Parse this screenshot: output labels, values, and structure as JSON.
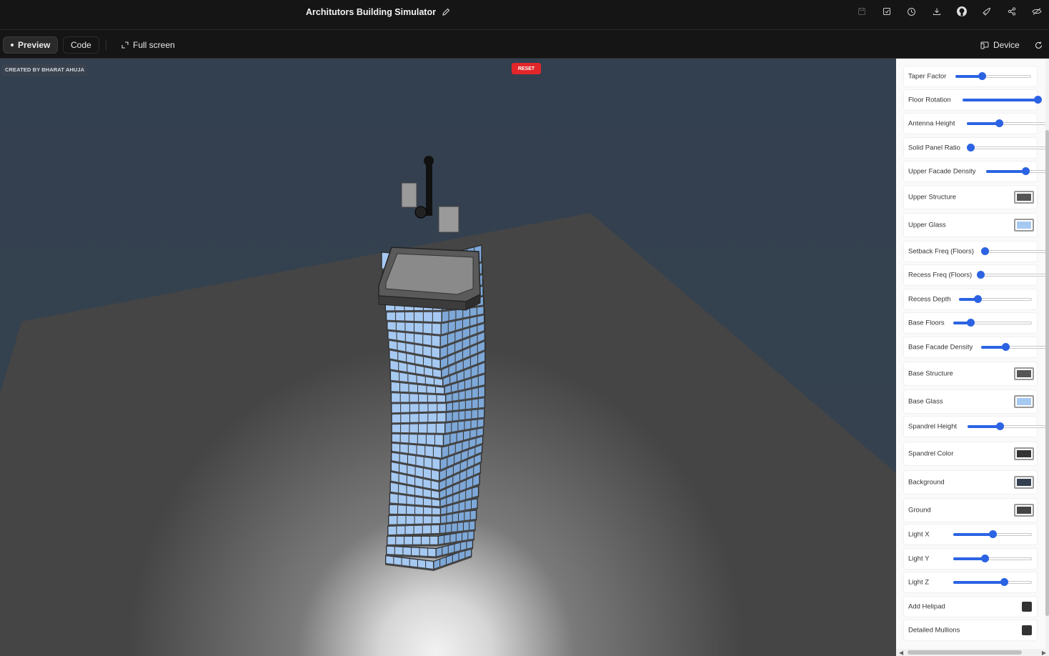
{
  "app": {
    "title": "Architutors Building Simulator"
  },
  "toolbar": {
    "preview_label": "Preview",
    "code_label": "Code",
    "fullscreen_label": "Full screen",
    "device_label": "Device"
  },
  "top_icons": [
    "save-icon",
    "save-as-icon",
    "history-icon",
    "download-icon",
    "github-icon",
    "deploy-rocket-icon",
    "share-icon",
    "hide-icon"
  ],
  "viewport": {
    "credit": "CREATED BY BHARAT AHUJA",
    "reset_label": "RESET"
  },
  "controls": [
    {
      "label": "Taper Factor",
      "type": "slider",
      "value": 0.35
    },
    {
      "label": "Floor Rotation",
      "type": "slider",
      "value": 0.97
    },
    {
      "label": "Antenna Height",
      "type": "slider",
      "value": 0.4
    },
    {
      "label": "Solid Panel Ratio",
      "type": "slider",
      "value": 0.0
    },
    {
      "label": "Upper Facade Density",
      "type": "slider",
      "value": 0.6
    },
    {
      "label": "Upper Structure",
      "type": "color",
      "value": "#555555"
    },
    {
      "label": "Upper Glass",
      "type": "color",
      "value": "#a6c9f2"
    },
    {
      "label": "Setback Freq (Floors)",
      "type": "slider",
      "value": 0.0
    },
    {
      "label": "Recess Freq (Floors)",
      "type": "slider",
      "value": 0.0
    },
    {
      "label": "Recess Depth",
      "type": "slider",
      "value": 0.25
    },
    {
      "label": "Base Floors",
      "type": "slider",
      "value": 0.22
    },
    {
      "label": "Base Facade Density",
      "type": "slider",
      "value": 0.35
    },
    {
      "label": "Base Structure",
      "type": "color",
      "value": "#555555"
    },
    {
      "label": "Base Glass",
      "type": "color",
      "value": "#a6c9f2"
    },
    {
      "label": "Spandrel Height",
      "type": "slider",
      "value": 0.4
    },
    {
      "label": "Spandrel Color",
      "type": "color",
      "value": "#333333"
    },
    {
      "label": "Background",
      "type": "color",
      "value": "#34404f"
    },
    {
      "label": "Ground",
      "type": "color",
      "value": "#444444"
    },
    {
      "label": "Light X",
      "type": "slider",
      "value": 0.5
    },
    {
      "label": "Light Y",
      "type": "slider",
      "value": 0.4
    },
    {
      "label": "Light Z",
      "type": "slider",
      "value": 0.65
    },
    {
      "label": "Add Helipad",
      "type": "checkbox",
      "value": false
    },
    {
      "label": "Detailed Mullions",
      "type": "checkbox",
      "value": false
    }
  ],
  "colors": {
    "accent": "#2b63e3",
    "reset": "#e2262a",
    "sky": "#34404f",
    "ground": "#444444"
  }
}
